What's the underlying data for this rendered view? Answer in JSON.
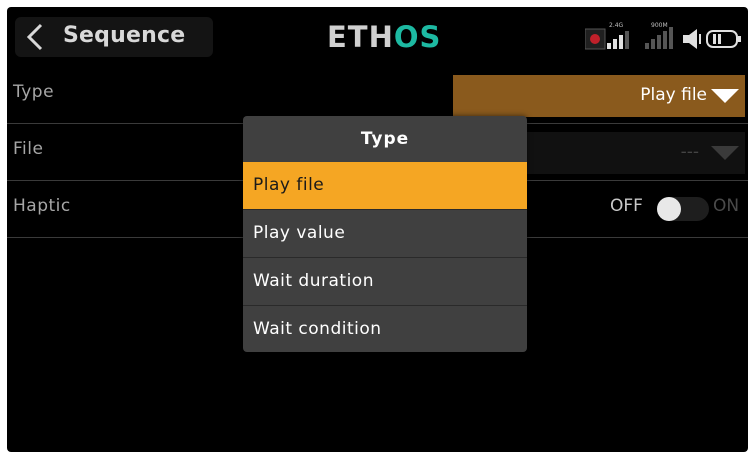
{
  "header": {
    "title": "Sequence",
    "logo_main": "ETH",
    "logo_accent": "OS",
    "signal_24_label": "2.4G",
    "signal_900_label": "900M"
  },
  "fields": [
    {
      "label": "Type",
      "value": "Play file"
    },
    {
      "label": "File",
      "value": "---"
    },
    {
      "label": "Haptic",
      "off_label": "OFF",
      "on_label": "ON",
      "state": "off"
    }
  ],
  "popup": {
    "title": "Type",
    "options": [
      "Play file",
      "Play value",
      "Wait duration",
      "Wait condition"
    ],
    "selected_index": 0
  },
  "colors": {
    "accent": "#f5a623",
    "logo_accent": "#1db9a2",
    "type_field_bg": "#8a5a1d",
    "popup_bg": "#404040"
  },
  "icons": {
    "back": "chevron-left-icon",
    "rf_indicator": "record-dot-icon",
    "signal": "signal-bars-icon",
    "speaker": "speaker-icon",
    "battery": "battery-icon"
  }
}
